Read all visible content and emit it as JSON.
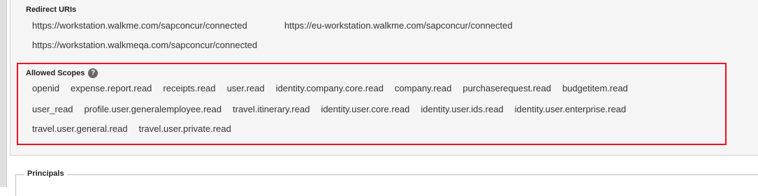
{
  "redirect": {
    "label": "Redirect URIs",
    "uris": [
      "https://workstation.walkme.com/sapconcur/connected",
      "https://eu-workstation.walkme.com/sapconcur/connected",
      "https://workstation.walkmeqa.com/sapconcur/connected"
    ]
  },
  "scopes": {
    "label": "Allowed Scopes",
    "help_icon": "?",
    "highlight_color": "#ef0c1f",
    "rows": [
      [
        "openid",
        "expense.report.read",
        "receipts.read",
        "user.read",
        "identity.company.core.read",
        "company.read",
        "purchaserequest.read",
        "budgetitem.read"
      ],
      [
        "user_read",
        "profile.user.generalemployee.read",
        "travel.itinerary.read",
        "identity.user.core.read",
        "identity.user.ids.read",
        "identity.user.enterprise.read"
      ],
      [
        "travel.user.general.read",
        "travel.user.private.read"
      ]
    ]
  },
  "principals": {
    "label": "Principals"
  }
}
